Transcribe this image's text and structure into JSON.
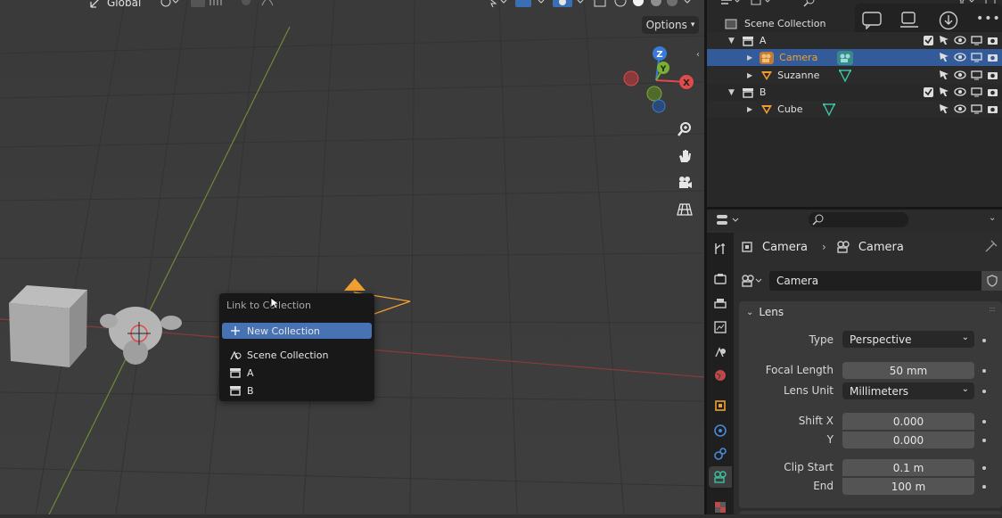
{
  "viewport": {
    "header": {
      "orientation_label": "Global"
    },
    "options_label": "Options",
    "gizmo": {
      "z": "Z",
      "y": "Y",
      "x": "X"
    }
  },
  "menu": {
    "title": "Link to Collection",
    "items": [
      {
        "label": "New Collection",
        "icon": "plus-icon"
      },
      {
        "label": "Scene Collection",
        "icon": "scene-collection-icon"
      },
      {
        "label": "A",
        "icon": "collection-icon"
      },
      {
        "label": "B",
        "icon": "collection-icon"
      }
    ]
  },
  "outliner": {
    "root": "Scene Collection",
    "rows": [
      {
        "label": "A",
        "type": "collection"
      },
      {
        "label": "Camera",
        "type": "camera",
        "selected": true
      },
      {
        "label": "Suzanne",
        "type": "mesh"
      },
      {
        "label": "B",
        "type": "collection"
      },
      {
        "label": "Cube",
        "type": "mesh"
      }
    ]
  },
  "properties": {
    "breadcrumb": {
      "object": "Camera",
      "data": "Camera"
    },
    "datablock_name": "Camera",
    "panel_title": "Lens",
    "type_label": "Type",
    "type_value": "Perspective",
    "focal_length_label": "Focal Length",
    "focal_length_value": "50 mm",
    "lens_unit_label": "Lens Unit",
    "lens_unit_value": "Millimeters",
    "shift_x_label": "Shift X",
    "shift_x_value": "0.000",
    "shift_y_label": "Y",
    "shift_y_value": "0.000",
    "clip_start_label": "Clip Start",
    "clip_start_value": "0.1 m",
    "clip_end_label": "End",
    "clip_end_value": "100 m"
  },
  "colors": {
    "selection": "#335a99",
    "menu_active": "#4772b3",
    "camera_orange": "#f0a030",
    "axis_red": "#e04a4a",
    "axis_green": "#7ab030",
    "axis_blue": "#3a7ad8"
  }
}
